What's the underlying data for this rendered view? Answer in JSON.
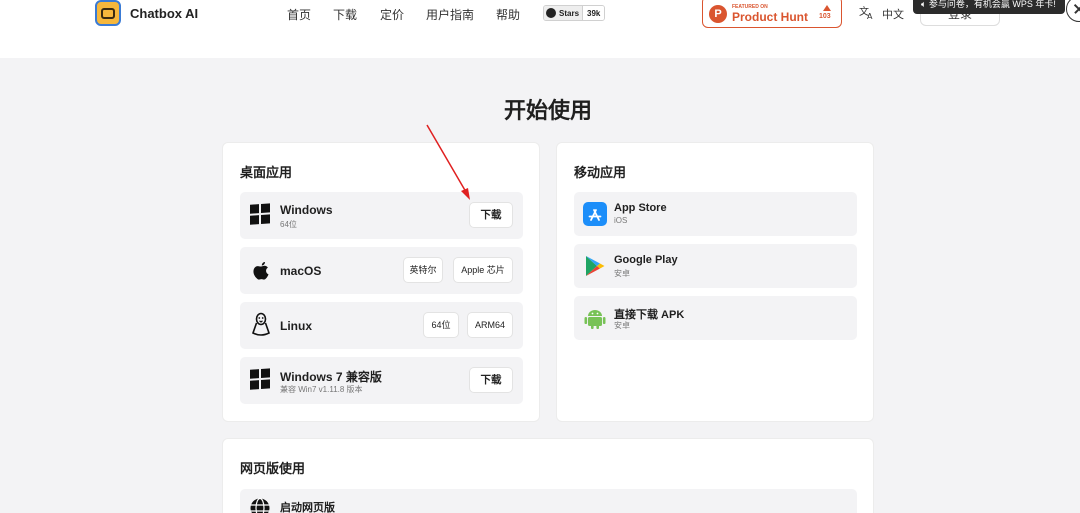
{
  "header": {
    "brand": "Chatbox AI",
    "nav": [
      "首页",
      "下载",
      "定价",
      "用户指南",
      "帮助"
    ],
    "github": {
      "label": "Stars",
      "count": "39k"
    },
    "producthunt": {
      "featured": "FEATURED ON",
      "name": "Product Hunt",
      "count": "103"
    },
    "language": "中文",
    "login": "登录",
    "toast": "参与问卷，有机会赢 WPS 年卡!"
  },
  "main": {
    "title": "开始使用",
    "desktop": {
      "title": "桌面应用",
      "windows": {
        "label": "Windows",
        "sub": "64位",
        "button": "下载"
      },
      "macos": {
        "label": "macOS",
        "buttons": [
          "英特尔",
          "Apple 芯片"
        ]
      },
      "linux": {
        "label": "Linux",
        "buttons": [
          "64位",
          "ARM64"
        ]
      },
      "win7": {
        "label": "Windows 7 兼容版",
        "sub": "兼容 Win7 v1.11.8 版本",
        "button": "下载"
      }
    },
    "mobile": {
      "title": "移动应用",
      "items": [
        {
          "label": "App Store",
          "sub": "iOS"
        },
        {
          "label": "Google Play",
          "sub": "安卓"
        },
        {
          "label": "直接下载 APK",
          "sub": "安卓"
        }
      ]
    },
    "web": {
      "title": "网页版使用",
      "launch": "启动网页版"
    }
  },
  "colors": {
    "accent_red": "#da552f",
    "annotation_arrow": "#e02020",
    "app_store_blue": "#1c8ef9",
    "android_green": "#78c257"
  }
}
